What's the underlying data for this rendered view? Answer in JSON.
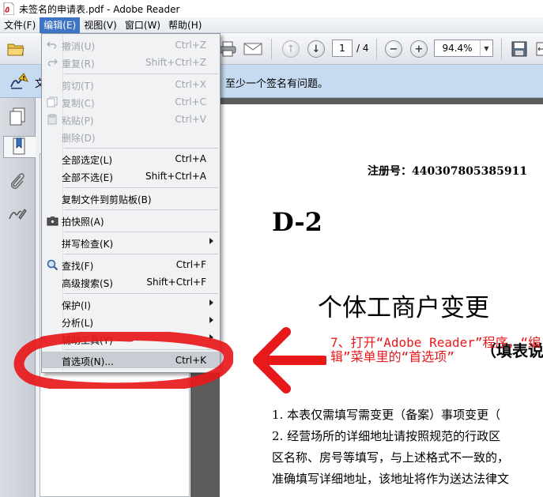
{
  "window": {
    "title": "未签名的申请表.pdf - Adobe Reader",
    "app_icon": "pdf-icon"
  },
  "menubar": {
    "items": [
      {
        "label": "文件(F)"
      },
      {
        "label": "编辑(E)",
        "active": true
      },
      {
        "label": "视图(V)"
      },
      {
        "label": "窗口(W)"
      },
      {
        "label": "帮助(H)"
      }
    ]
  },
  "toolbar": {
    "page_current": "1",
    "page_total": "/ 4",
    "zoom": "94.4%",
    "icons": [
      "open-folder-icon",
      "print-icon",
      "email-icon",
      "page-up-icon",
      "page-down-icon",
      "zoom-out-icon",
      "zoom-in-icon",
      "save-icon",
      "fit-width-icon"
    ]
  },
  "notice": {
    "text_left": "文",
    "text": "至少一个签名有问题。",
    "icon": "signature-warning-icon"
  },
  "leftnav": {
    "icons": [
      "pages-icon",
      "bookmarks-icon",
      "attachments-icon",
      "signatures-icon"
    ]
  },
  "edit_menu": {
    "items": [
      {
        "label": "撤消(U)",
        "shortcut": "Ctrl+Z",
        "disabled": true,
        "icon": "undo-icon"
      },
      {
        "label": "重复(R)",
        "shortcut": "Shift+Ctrl+Z",
        "disabled": true,
        "icon": "redo-icon"
      },
      {
        "label": "剪切(T)",
        "shortcut": "Ctrl+X",
        "disabled": true
      },
      {
        "label": "复制(C)",
        "shortcut": "Ctrl+C",
        "disabled": true,
        "icon": "copy-icon"
      },
      {
        "label": "粘贴(P)",
        "shortcut": "Ctrl+V",
        "disabled": true,
        "icon": "paste-icon"
      },
      {
        "label": "删除(D)",
        "shortcut": "",
        "disabled": true
      },
      {
        "label": "全部选定(L)",
        "shortcut": "Ctrl+A"
      },
      {
        "label": "全部不选(E)",
        "shortcut": "Shift+Ctrl+A"
      },
      {
        "label": "复制文件到剪贴板(B)",
        "shortcut": ""
      },
      {
        "label": "拍快照(A)",
        "shortcut": "",
        "icon": "camera-icon"
      },
      {
        "label": "拼写检查(K)",
        "shortcut": "",
        "submenu": true
      },
      {
        "label": "查找(F)",
        "shortcut": "Ctrl+F",
        "icon": "search-icon"
      },
      {
        "label": "高级搜索(S)",
        "shortcut": "Shift+Ctrl+F"
      },
      {
        "label": "保护(I)",
        "shortcut": "",
        "submenu": true
      },
      {
        "label": "分析(L)",
        "shortcut": "",
        "submenu": true
      },
      {
        "label": "辅助工具(Y)",
        "shortcut": "",
        "submenu": true
      },
      {
        "label": "首选项(N)...",
        "shortcut": "Ctrl+K",
        "highlighted": true
      }
    ]
  },
  "document": {
    "reg_no": "注册号：440307805385911",
    "code": "D-2",
    "title": "个体工商户变更",
    "subtitle": "（填表说",
    "lines": [
      "1.  本表仅需填写需变更（备案）事项变更（",
      "2.  经营场所的详细地址请按照规范的行政区",
      "区名称、房号等填写，与上述格式不一致的，",
      "准确填写详细地址，该地址将作为送达法律文"
    ]
  },
  "annotation": {
    "text": "7、打开“Adobe Reader”程序，“编辑”菜单里的“首选项”",
    "color": "#e8191b"
  }
}
